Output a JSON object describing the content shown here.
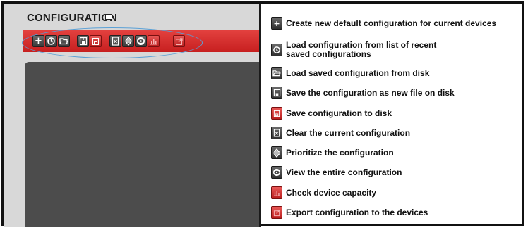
{
  "panel": {
    "title": "CONFIGURATION"
  },
  "toolbar": {
    "icons": [
      "plus-icon",
      "history-icon",
      "folder-open-icon",
      "save-as-icon",
      "save-icon",
      "clear-icon",
      "prioritize-icon",
      "view-icon",
      "capacity-icon",
      "export-icon"
    ]
  },
  "legend": {
    "items": [
      {
        "icon": "plus-icon",
        "text": "Create new default configuration for current devices"
      },
      {
        "icon": "history-icon",
        "text": "Load configuration from list of recent saved configurations"
      },
      {
        "icon": "folder-open-icon",
        "text": "Load saved configuration from disk"
      },
      {
        "icon": "save-as-icon",
        "text": "Save the configuration as new file on disk"
      },
      {
        "icon": "save-icon",
        "text": "Save configuration to disk"
      },
      {
        "icon": "clear-icon",
        "text": "Clear the current configuration"
      },
      {
        "icon": "prioritize-icon",
        "text": "Prioritize the configuration"
      },
      {
        "icon": "view-icon",
        "text": "View the entire configuration"
      },
      {
        "icon": "capacity-icon",
        "text": "Check device capacity"
      },
      {
        "icon": "export-icon",
        "text": "Export configuration to the devices"
      }
    ]
  },
  "colors": {
    "toolbar_red": "#d42a2a",
    "highlight_ellipse": "#5aa0d6",
    "canvas": "#4c4c4c"
  }
}
